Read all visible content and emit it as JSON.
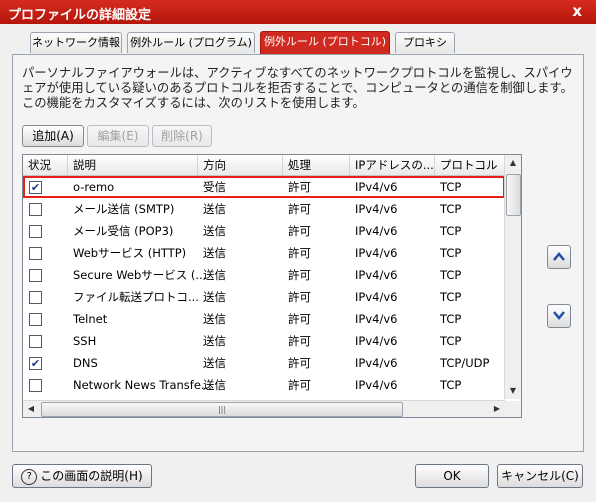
{
  "window": {
    "title": "プロファイルの詳細設定",
    "close_label": "x"
  },
  "tabs": [
    {
      "label": "ネットワーク情報",
      "active": false
    },
    {
      "label": "例外ルール (プログラム)",
      "active": false
    },
    {
      "label": "例外ルール (プロトコル)",
      "active": true
    },
    {
      "label": "プロキシ",
      "active": false
    }
  ],
  "description": [
    "パーソナルファイアウォールは、アクティブなすべてのネットワークプロトコルを監視し、スパイウ",
    "ェアが使用している疑いのあるプロトコルを拒否することで、コンピュータとの通信を制御します。",
    "この機能をカスタマイズするには、次のリストを使用します。"
  ],
  "toolbar": {
    "add_label": "追加(A)",
    "edit_label": "編集(E)",
    "delete_label": "削除(R)"
  },
  "table": {
    "columns": [
      "状況",
      "説明",
      "方向",
      "処理",
      "IPアドレスの...",
      "プロトコル"
    ],
    "rows": [
      {
        "checked": true,
        "description": "o-remo",
        "direction": "受信",
        "action": "許可",
        "ip": "IPv4/v6",
        "protocol": "TCP",
        "selected": true
      },
      {
        "checked": false,
        "description": "メール送信 (SMTP)",
        "direction": "送信",
        "action": "許可",
        "ip": "IPv4/v6",
        "protocol": "TCP"
      },
      {
        "checked": false,
        "description": "メール受信 (POP3)",
        "direction": "送信",
        "action": "許可",
        "ip": "IPv4/v6",
        "protocol": "TCP"
      },
      {
        "checked": false,
        "description": "Webサービス (HTTP)",
        "direction": "送信",
        "action": "許可",
        "ip": "IPv4/v6",
        "protocol": "TCP"
      },
      {
        "checked": false,
        "description": "Secure Webサービス (...",
        "direction": "送信",
        "action": "許可",
        "ip": "IPv4/v6",
        "protocol": "TCP"
      },
      {
        "checked": false,
        "description": "ファイル転送プロトコ...",
        "direction": "送信",
        "action": "許可",
        "ip": "IPv4/v6",
        "protocol": "TCP"
      },
      {
        "checked": false,
        "description": "Telnet",
        "direction": "送信",
        "action": "許可",
        "ip": "IPv4/v6",
        "protocol": "TCP"
      },
      {
        "checked": false,
        "description": "SSH",
        "direction": "送信",
        "action": "許可",
        "ip": "IPv4/v6",
        "protocol": "TCP"
      },
      {
        "checked": true,
        "description": "DNS",
        "direction": "送信",
        "action": "許可",
        "ip": "IPv4/v6",
        "protocol": "TCP/UDP"
      },
      {
        "checked": false,
        "description": "Network News Transfe...",
        "direction": "送信",
        "action": "許可",
        "ip": "IPv4/v6",
        "protocol": "TCP"
      }
    ]
  },
  "buttons": {
    "help_label": "この画面の説明(H)",
    "ok_label": "OK",
    "cancel_label": "キャンセル(C)"
  },
  "colors": {
    "accent": "#d02a20",
    "selection_outline": "#e8201c"
  }
}
